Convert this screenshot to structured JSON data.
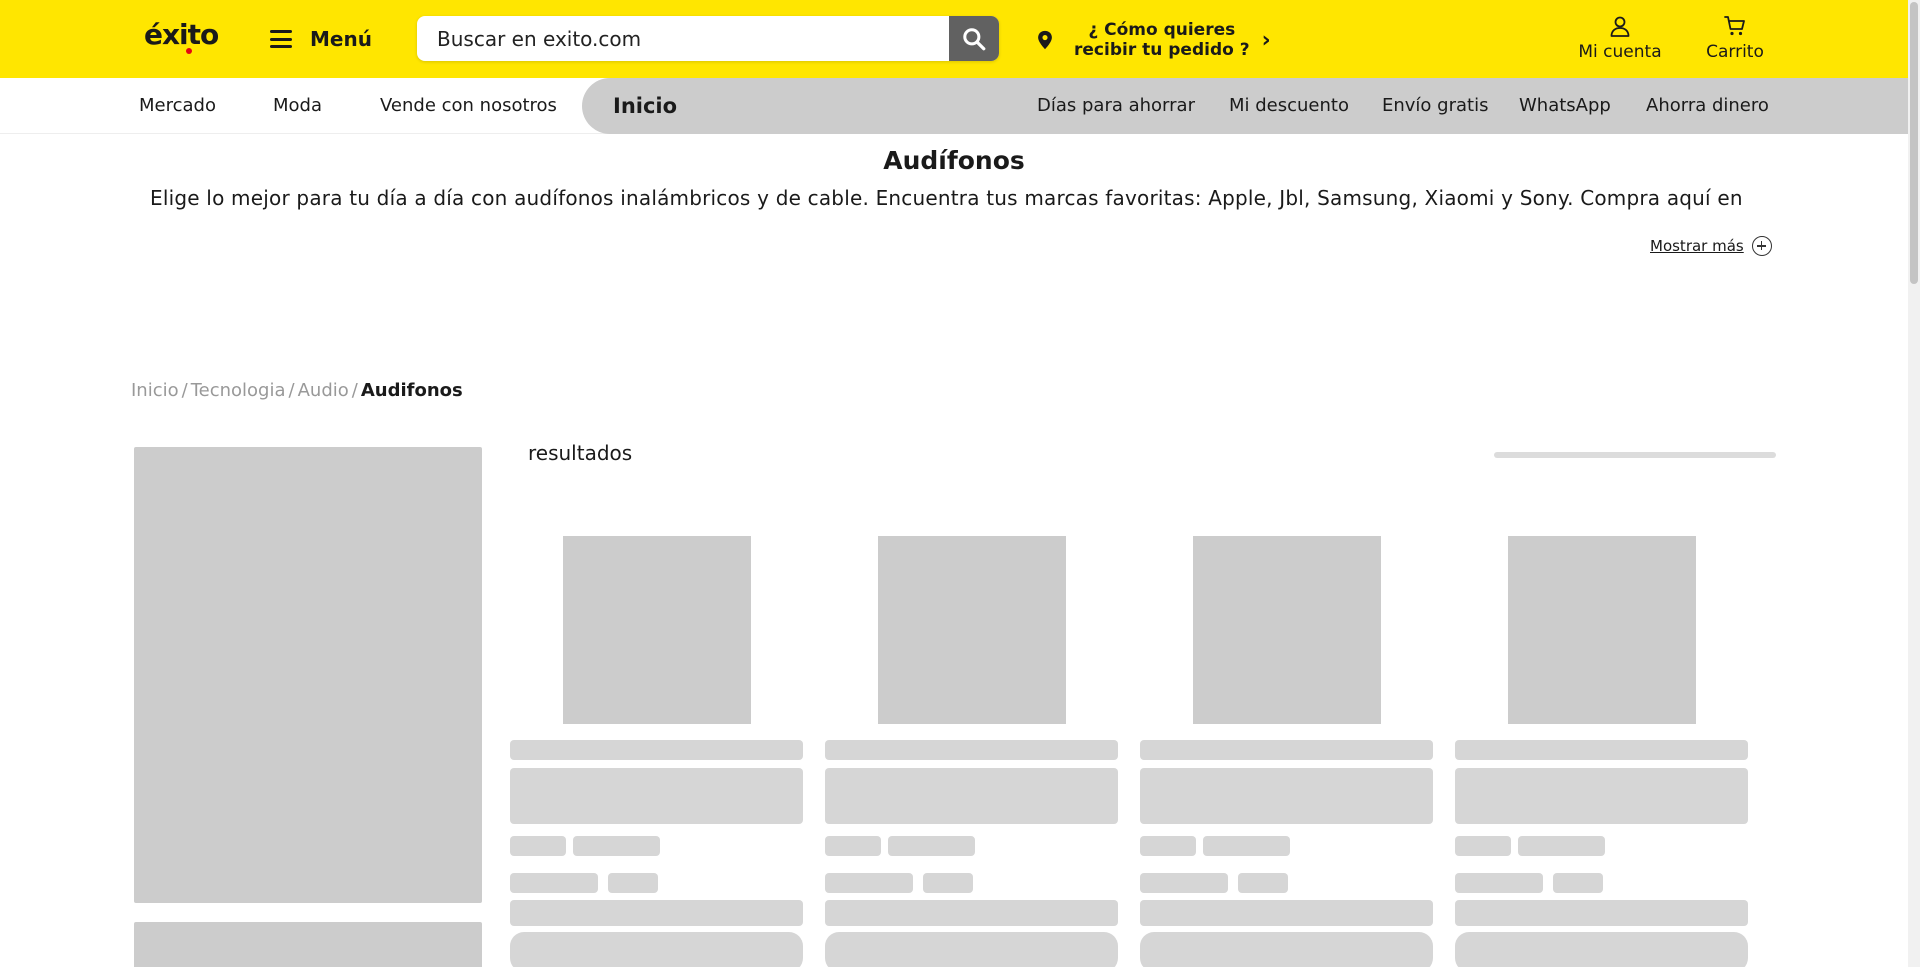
{
  "header": {
    "logo_text": "éxito",
    "menu_label": "Menú",
    "search_placeholder": "Buscar en exito.com",
    "delivery_line1": "¿ Cómo quieres",
    "delivery_line2": "recibir tu pedido ?",
    "account_label": "Mi cuenta",
    "cart_label": "Carrito"
  },
  "subnav": {
    "left": [
      "Mercado",
      "Moda",
      "Vende con nosotros"
    ],
    "inicio": "Inicio",
    "right": [
      "Días para ahorrar",
      "Mi descuento",
      "Envío gratis",
      "WhatsApp",
      "Ahorra dinero"
    ]
  },
  "category": {
    "title": "Audífonos",
    "description": "Elige lo mejor para tu día a día con audífonos inalámbricos y de cable. Encuentra tus marcas favoritas: Apple, Jbl, Samsung, Xiaomi y Sony. Compra aquí en",
    "show_more": "Mostrar más"
  },
  "breadcrumb": {
    "items": [
      "Inicio",
      "Tecnologia",
      "Audio"
    ],
    "current": "Audifonos"
  },
  "results": {
    "label": "resultados"
  },
  "colors": {
    "brand_yellow": "#ffe600",
    "skeleton": "#d6d6d6",
    "search_button": "#616161"
  }
}
